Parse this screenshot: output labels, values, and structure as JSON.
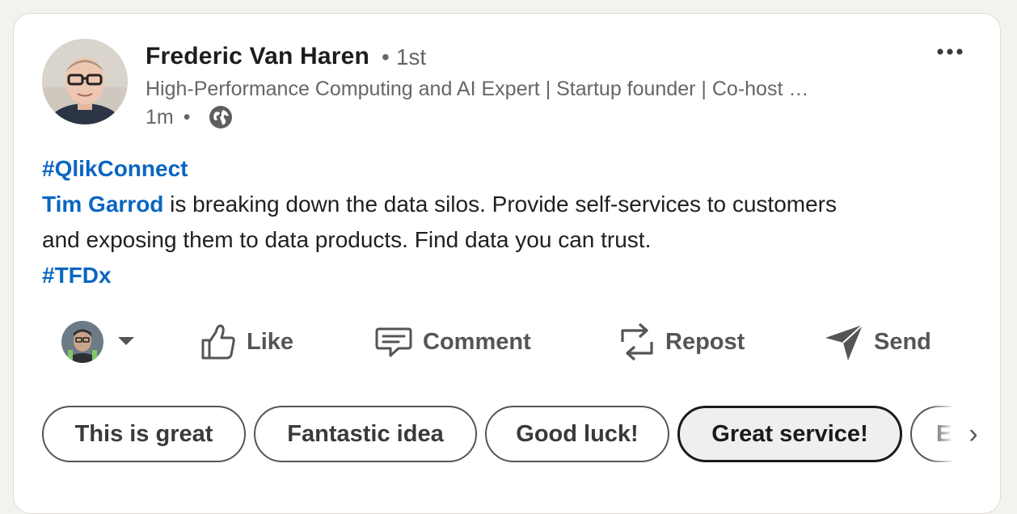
{
  "post": {
    "author": {
      "name": "Frederic Van Haren",
      "degree_dot": "•",
      "degree": "1st",
      "headline": "High-Performance Computing and AI Expert | Startup founder | Co-host …",
      "time": "1m",
      "time_sep": "•",
      "visibility_icon": "globe-icon"
    },
    "more_icon": "ellipsis-icon",
    "body": {
      "hashtag1": "#QlikConnect",
      "mention": "Tim Garrod",
      "line1_rest": " is breaking down the data silos. Provide self-services to customers",
      "line2": "and exposing them to data products. Find data you can trust.",
      "hashtag2": "#TFDx"
    }
  },
  "actions": {
    "like": "Like",
    "comment": "Comment",
    "repost": "Repost",
    "send": "Send"
  },
  "suggestions": [
    "This is great",
    "Fantastic idea",
    "Good luck!",
    "Great service!",
    "Ex"
  ],
  "suggestion_next": "›",
  "colors": {
    "link": "#0a66c2",
    "muted": "#666666",
    "action": "#555555"
  }
}
